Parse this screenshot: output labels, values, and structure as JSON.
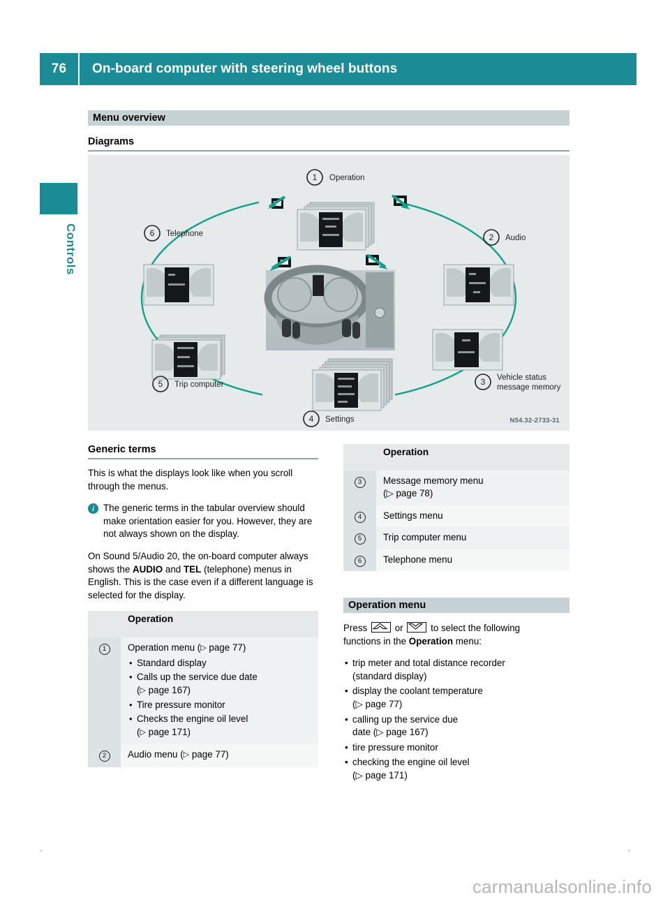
{
  "header": {
    "page_number": "76",
    "title": "On-board computer with steering wheel buttons",
    "accent_color": "#1b8b96"
  },
  "sidebar": {
    "chapter_label": "Controls",
    "marker_color": "#1b8b96"
  },
  "sections": {
    "menu_overview_bar": "Menu overview",
    "diagrams_heading": "Diagrams"
  },
  "figure": {
    "id_code": "N54.32-2733-31",
    "background_color": "#e7eaea",
    "line_color": "#11a08c",
    "callouts": [
      {
        "num": "1",
        "label": "Operation"
      },
      {
        "num": "2",
        "label": "Audio"
      },
      {
        "num": "3",
        "label": "Vehicle status\nmessage memory"
      },
      {
        "num": "4",
        "label": "Settings"
      },
      {
        "num": "5",
        "label": "Trip computer"
      },
      {
        "num": "6",
        "label": "Telephone"
      }
    ],
    "callout_3_line1": "Vehicle status",
    "callout_3_line2": "message memory"
  },
  "left_column": {
    "generic_terms_heading": "Generic terms",
    "paragraph_1": "This is what the displays look like when you scroll through the menus.",
    "note_icon": "info-icon",
    "note_text": "The generic terms in the tabular overview should make orientation easier for you. However, they are not always shown on the display.",
    "paragraph_2_a": "On Sound 5/Audio 20, the on-board computer always shows the ",
    "paragraph_2_b": "AUDIO",
    "paragraph_2_c": " and ",
    "paragraph_2_d": "TEL",
    "paragraph_2_e": " (telephone) menus in English. This is the case even if a different language is selected for the display.",
    "table": {
      "header": "Operation",
      "rows": [
        {
          "num": "1",
          "text": "Operation menu (",
          "ref": "page 77",
          "text_after": ")",
          "bullets": [
            {
              "text": "Standard display",
              "ref": ""
            },
            {
              "text": "Calls up the service due date",
              "ref": "page 167"
            },
            {
              "text": "Tire pressure monitor",
              "ref": ""
            },
            {
              "text": "Checks the engine oil level",
              "ref": "page 171"
            }
          ]
        },
        {
          "num": "2",
          "text": "Audio menu (",
          "ref": "page 77",
          "text_after": ")",
          "bullets": []
        }
      ]
    }
  },
  "right_column": {
    "table": {
      "header": "Operation",
      "rows": [
        {
          "num": "3",
          "text": "Message memory menu",
          "ref_line": "(▷ page 78)"
        },
        {
          "num": "4",
          "text": "Settings menu",
          "ref_line": ""
        },
        {
          "num": "5",
          "text": "Trip computer menu",
          "ref_line": ""
        },
        {
          "num": "6",
          "text": "Telephone menu",
          "ref_line": ""
        }
      ]
    },
    "operation_menu_bar": "Operation menu",
    "press_prefix": "Press",
    "press_or": "or",
    "press_suffix": "to select the following",
    "press_line2_a": "functions in the ",
    "press_line2_b": "Operation",
    "press_line2_c": " menu:",
    "up_button_icon": "chevron-up-icon",
    "down_button_icon": "chevron-down-icon",
    "bullets": [
      {
        "line1": "trip meter and total distance recorder",
        "line2": "(standard display)"
      },
      {
        "line1": "display the coolant temperature",
        "line2": "(▷ page 77)"
      },
      {
        "line1": "calling up the service due",
        "line2": "date (▷ page 167)"
      },
      {
        "line1": "tire pressure monitor",
        "line2": ""
      },
      {
        "line1": "checking the engine oil level",
        "line2": "(▷ page 171)"
      }
    ]
  },
  "footer": {
    "watermark": "carmanualsonline.info"
  }
}
